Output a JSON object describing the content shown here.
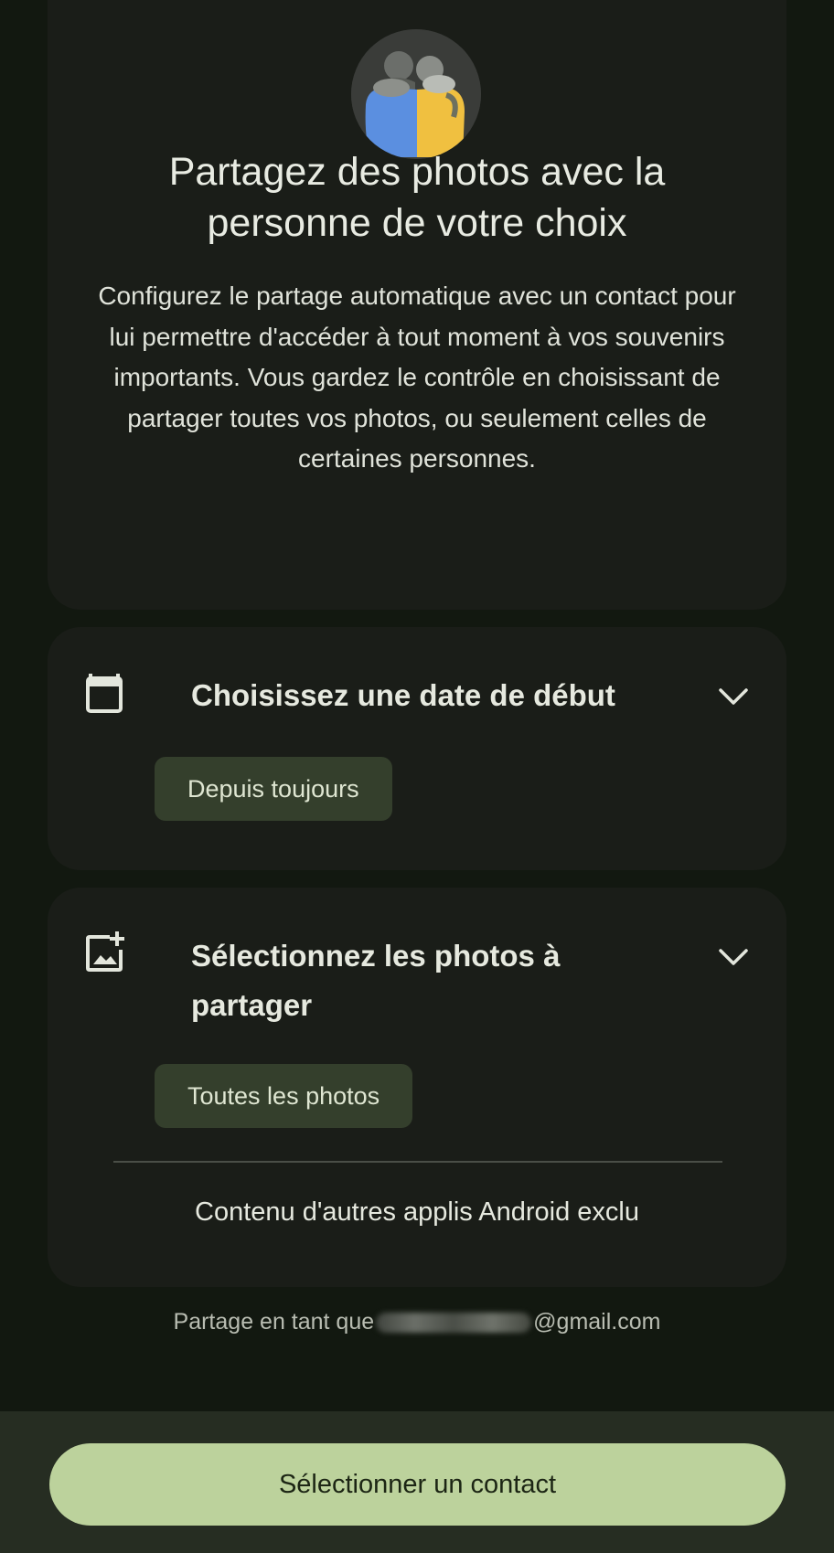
{
  "intro": {
    "title": "Partagez des photos avec la\npersonne de votre choix",
    "description": "Configurez le partage automatique avec un contact pour lui permettre d'accéder à tout moment à vos souvenirs importants. Vous gardez le contrôle en choisissant de partager toutes vos photos, ou seulement celles de certaines personnes."
  },
  "start_date": {
    "icon": "calendar-icon",
    "title": "Choisissez une date de début",
    "chip_label": "Depuis toujours"
  },
  "photo_selection": {
    "icon": "add-photo-icon",
    "title": "Sélectionnez les photos à partager",
    "chip_label": "Toutes les photos",
    "note": "Contenu d'autres applis Android exclu"
  },
  "share_as": {
    "prefix": "Partage en tant que",
    "email_suffix": "@gmail.com"
  },
  "primary_button_label": "Sélectionner un contact",
  "colors": {
    "background": "#121810",
    "card": "#1a1d18",
    "chip": "#343f2c",
    "primary_button": "#bcd29c",
    "bottom_bar": "#262d22"
  }
}
